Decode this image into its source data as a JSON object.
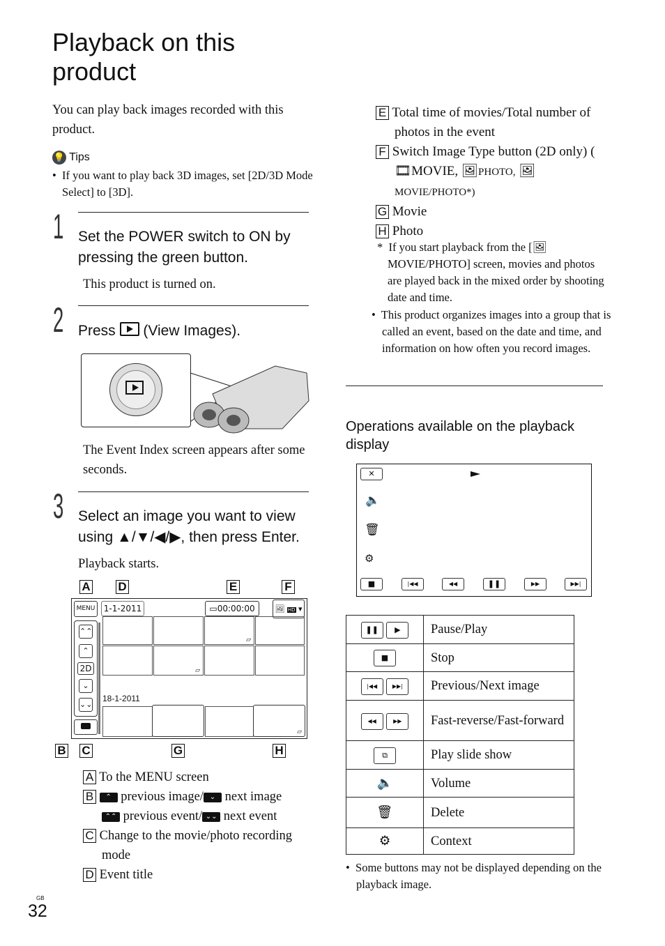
{
  "title": {
    "line1": "Playback on this",
    "line2": "product"
  },
  "intro": "You can play back images recorded with this product.",
  "tips": {
    "label": "Tips",
    "items": [
      "If you want to play back 3D images, set [2D/3D Mode Select] to [3D]."
    ]
  },
  "steps": [
    {
      "num": "1",
      "text": "Set the POWER switch to ON by pressing the green button.",
      "result": "This product is turned on."
    },
    {
      "num": "2",
      "text_before": "Press",
      "text_after": "(View Images).",
      "result": "The Event Index screen appears after some seconds."
    },
    {
      "num": "3",
      "text": "Select an image you want to view using ▲/▼/◀/▶, then press Enter.",
      "result": "Playback starts."
    }
  ],
  "screen": {
    "callouts": {
      "a": "A",
      "b": "B",
      "c": "C",
      "d": "D",
      "e": "E",
      "f": "F",
      "g": "G",
      "h": "H"
    },
    "menu_button": "MENU",
    "event_title": "1-1-2011",
    "total_time": "00:00:00",
    "mode_button": "2D",
    "second_event": "18-1-2011",
    "hd_badge": "HD"
  },
  "legend_left": [
    {
      "key": "A",
      "text": "To the MENU screen"
    },
    {
      "key": "B",
      "line1_a": "previous image/",
      "line1_b": "next image",
      "line2_a": "previous event/",
      "line2_b": "next event"
    },
    {
      "key": "C",
      "text": "Change to the movie/photo recording mode"
    },
    {
      "key": "D",
      "text": "Event title"
    }
  ],
  "legend_right": [
    {
      "key": "E",
      "text": "Total time of movies/Total number of photos in the event"
    },
    {
      "key": "F",
      "text_a": "Switch Image Type button (2D only) (",
      "movie": "MOVIE,",
      "photo": "PHOTO,",
      "moviephoto": "MOVIE/PHOTO*)"
    },
    {
      "key": "G",
      "text": "Movie"
    },
    {
      "key": "H",
      "text": "Photo"
    }
  ],
  "footnote": {
    "mark": "*",
    "text_a": "If you start playback from the [",
    "text_b": "MOVIE/PHOTO] screen, movies and photos are played back in the mixed order by shooting date and time."
  },
  "bullet_event": "This product organizes images into a group that is called an event, based on the date and time, and information on how often you record images.",
  "operations": {
    "heading": "Operations available on the playback display",
    "rows": [
      {
        "icons": [
          "pause-icon",
          "play-icon"
        ],
        "label": "Pause/Play"
      },
      {
        "icons": [
          "stop-icon"
        ],
        "label": "Stop"
      },
      {
        "icons": [
          "previous-icon",
          "next-icon"
        ],
        "label": "Previous/Next image"
      },
      {
        "icons": [
          "fast-reverse-icon",
          "fast-forward-icon"
        ],
        "label": "Fast-reverse/Fast-forward"
      },
      {
        "icons": [
          "slide-show-icon"
        ],
        "label": "Play slide show"
      },
      {
        "icons": [
          "volume-icon"
        ],
        "label": "Volume"
      },
      {
        "icons": [
          "delete-icon"
        ],
        "label": "Delete"
      },
      {
        "icons": [
          "context-icon"
        ],
        "label": "Context"
      }
    ],
    "note": "Some buttons may not be displayed depending on the playback image."
  },
  "footer": {
    "region": "GB",
    "page": "32"
  }
}
